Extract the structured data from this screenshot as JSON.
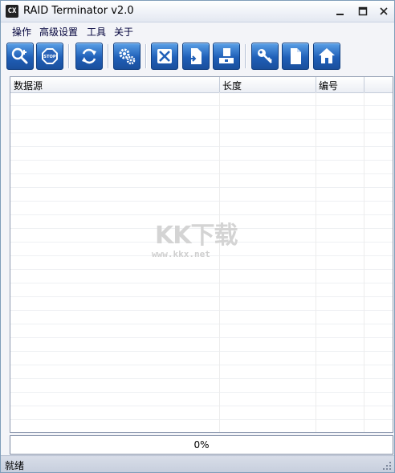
{
  "window": {
    "title": "RAID Terminator v2.0",
    "icon_text": "CX"
  },
  "menu": [
    {
      "label": "操作"
    },
    {
      "label": "高级设置"
    },
    {
      "label": "工具"
    },
    {
      "label": "关于"
    }
  ],
  "toolbar": [
    {
      "icon": "zoom-in-icon"
    },
    {
      "icon": "stop-icon",
      "text": "STOP"
    },
    {
      "icon": "refresh-icon"
    },
    {
      "icon": "gear-icon"
    },
    {
      "icon": "clear-icon"
    },
    {
      "icon": "document-arrow-icon"
    },
    {
      "icon": "save-disk-icon"
    },
    {
      "icon": "key-icon"
    },
    {
      "icon": "document-icon"
    },
    {
      "icon": "home-icon"
    }
  ],
  "list": {
    "columns": [
      {
        "label": "数据源"
      },
      {
        "label": "长度"
      },
      {
        "label": "编号"
      }
    ],
    "rows": []
  },
  "watermark": {
    "logo": "KK下载",
    "url": "www.kkx.net"
  },
  "progress": {
    "value": 0,
    "label": "0%"
  },
  "status": {
    "text": "就绪"
  },
  "colors": {
    "toolbar_button": "#1f5fb8",
    "progress_fill": "#3a7bd5"
  }
}
